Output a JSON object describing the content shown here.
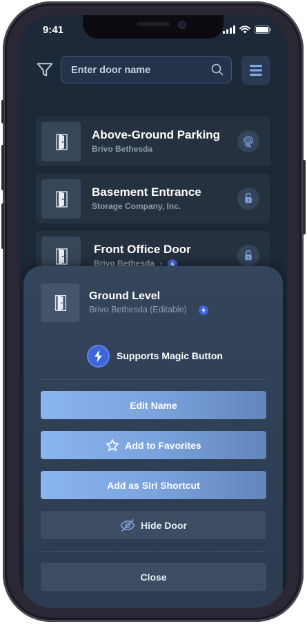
{
  "status_bar": {
    "time": "9:41"
  },
  "search": {
    "placeholder": "Enter door name"
  },
  "icons": {
    "filter": "filter-icon",
    "search": "search-icon",
    "menu": "menu-icon",
    "door": "door-icon",
    "fingerprint": "fingerprint-icon",
    "lock": "lock-icon",
    "bolt": "lightning-bolt-icon",
    "star": "star-icon",
    "eye_slash": "eye-slash-icon"
  },
  "doors": [
    {
      "title": "Above-Ground Parking",
      "subtitle": "Brivo Bethesda",
      "action": "fingerprint-icon"
    },
    {
      "title": "Basement Entrance",
      "subtitle": "Storage Company, Inc.",
      "action": "lock-icon"
    },
    {
      "title": "Front Office Door",
      "subtitle": "Brivo Bethesda",
      "action": "lock-icon",
      "magic": true
    }
  ],
  "sheet": {
    "title": "Ground Level",
    "subtitle": "Brivo Bethesda (Editable)",
    "magic_label": "Supports Magic Button",
    "edit_name": "Edit Name",
    "add_favorites": "Add to Favorites",
    "add_siri": "Add as Siri Shortcut",
    "hide_door": "Hide Door",
    "close": "Close"
  },
  "colors": {
    "background": "#1c2737",
    "card": "#25313f",
    "sheet": "#34455c",
    "primary_button": "#7ba3dc",
    "secondary_button": "#3c4c62",
    "magic_accent": "#3d66d8"
  }
}
